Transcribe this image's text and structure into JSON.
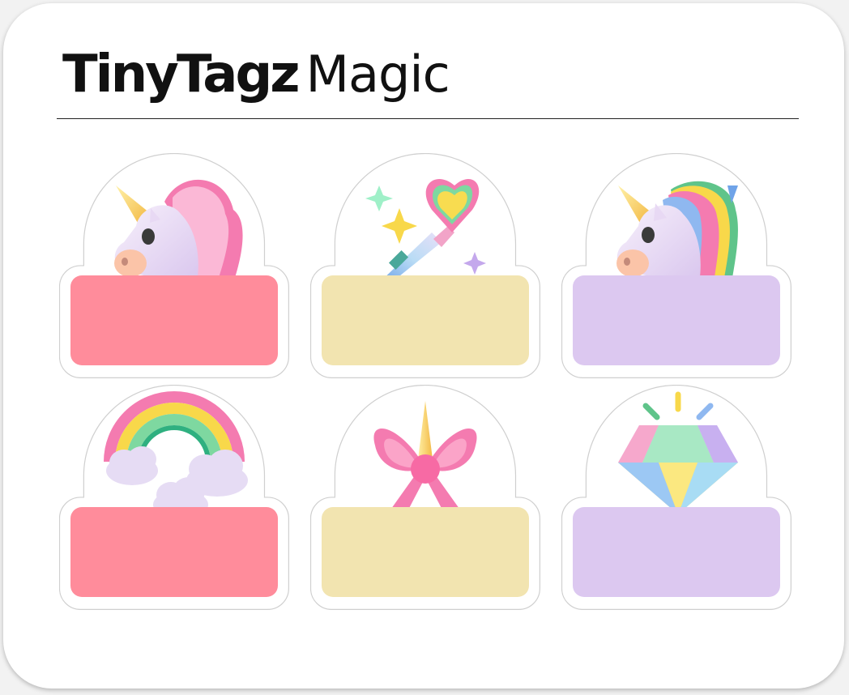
{
  "brand": {
    "name_bold": "TinyTagz",
    "name_light": "Magic"
  },
  "tags": [
    {
      "icon": "unicorn-pink-mane-icon",
      "label_color": "#ff8c9b"
    },
    {
      "icon": "magic-wand-heart-icon",
      "label_color": "#f2e4b0"
    },
    {
      "icon": "unicorn-rainbow-mane-icon",
      "label_color": "#dcc8f0"
    },
    {
      "icon": "rainbow-clouds-icon",
      "label_color": "#ff8c9b"
    },
    {
      "icon": "pink-bow-horn-icon",
      "label_color": "#f2e4b0"
    },
    {
      "icon": "rainbow-diamond-icon",
      "label_color": "#dcc8f0"
    }
  ]
}
